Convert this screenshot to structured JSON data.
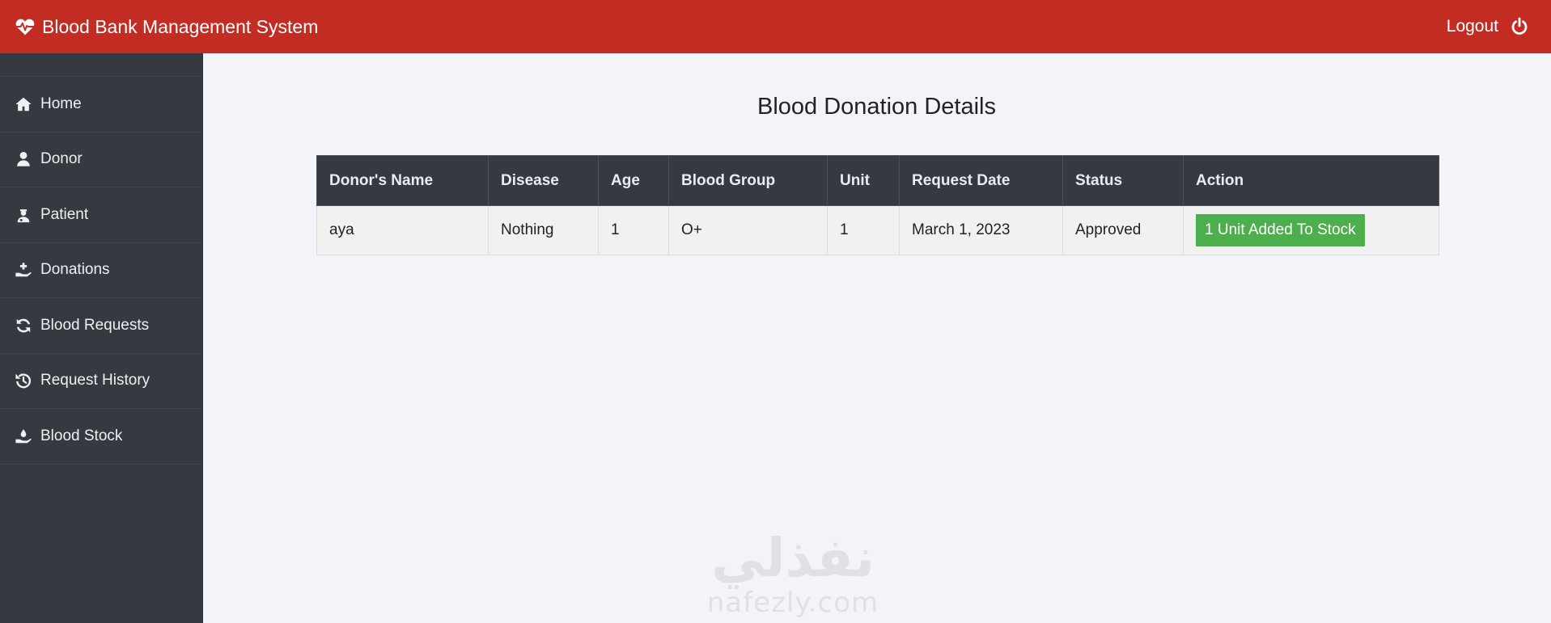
{
  "header": {
    "title": "Blood Bank Management System",
    "logout_label": "Logout",
    "bg_color": "#c32c22"
  },
  "sidebar": {
    "items": [
      {
        "label": "Home",
        "icon": "home-icon"
      },
      {
        "label": "Donor",
        "icon": "user-icon"
      },
      {
        "label": "Patient",
        "icon": "patient-icon"
      },
      {
        "label": "Donations",
        "icon": "donate-hand-icon"
      },
      {
        "label": "Blood Requests",
        "icon": "refresh-icon"
      },
      {
        "label": "Request History",
        "icon": "history-icon"
      },
      {
        "label": "Blood Stock",
        "icon": "blood-hand-icon"
      }
    ]
  },
  "main": {
    "title": "Blood Donation Details",
    "table": {
      "headers": [
        "Donor's Name",
        "Disease",
        "Age",
        "Blood Group",
        "Unit",
        "Request Date",
        "Status",
        "Action"
      ],
      "rows": [
        {
          "name": "aya",
          "disease": "Nothing",
          "age": "1",
          "blood_group": "O+",
          "unit": "1",
          "request_date": "March 1, 2023",
          "status": "Approved",
          "action_label": "1 Unit Added To Stock"
        }
      ]
    }
  },
  "watermark": {
    "logo": "نفذلي",
    "url": "nafezly.com"
  }
}
